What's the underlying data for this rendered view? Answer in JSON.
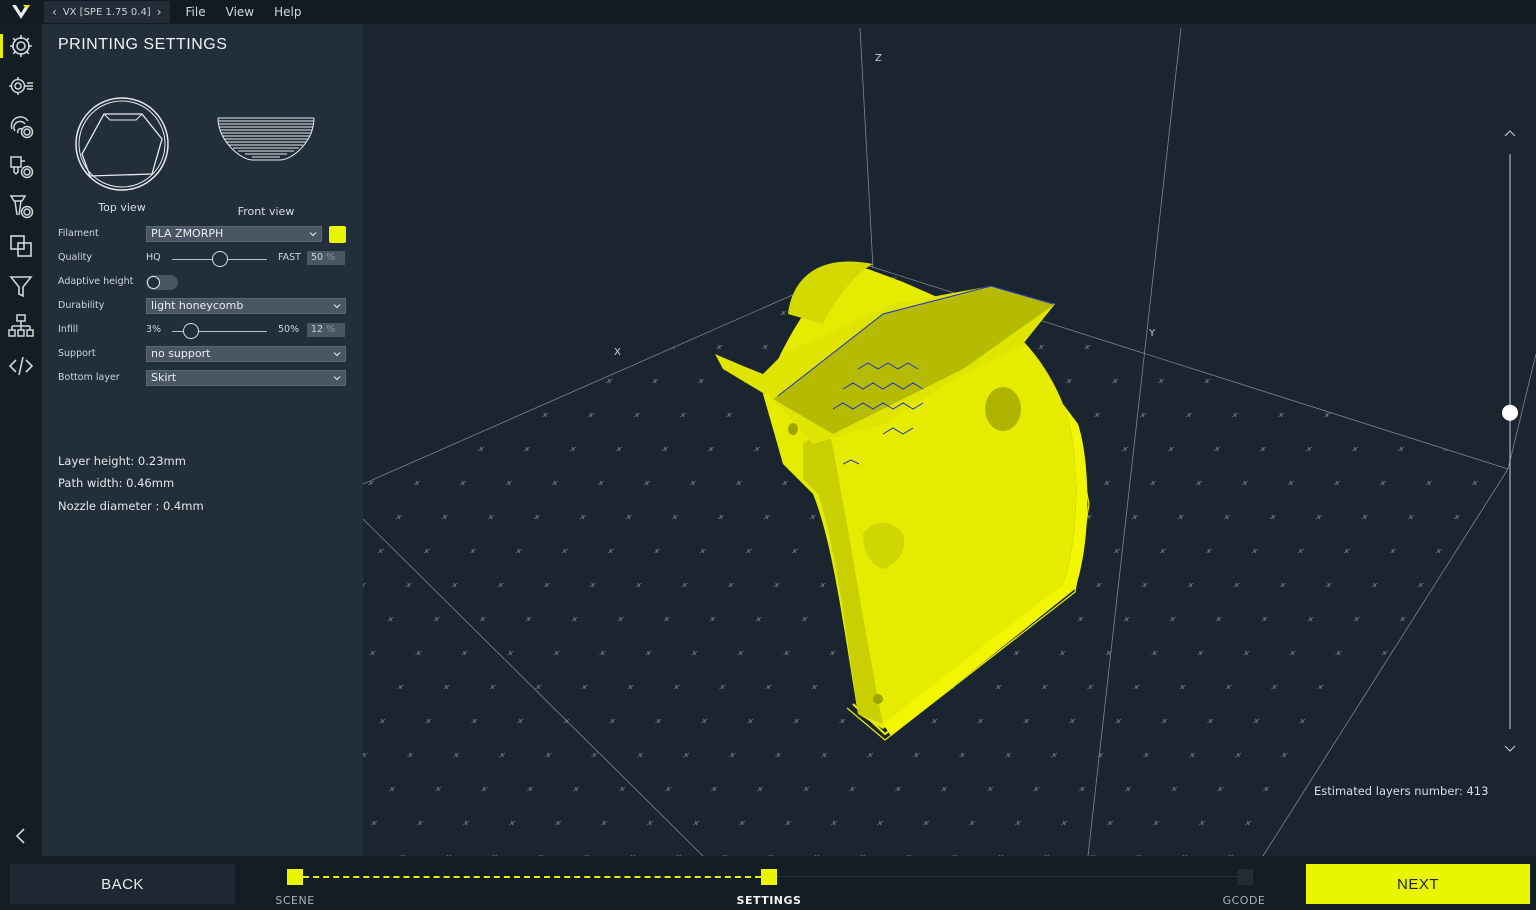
{
  "topbar": {
    "logo_icon": "v-logo-icon",
    "profile_label": "VX [SPE 1.75 0.4]",
    "menu": [
      "File",
      "View",
      "Help"
    ]
  },
  "rail": {
    "icons": [
      "gear-icon",
      "gear-list-icon",
      "fingerprint-gear-icon",
      "extruder-gear-icon",
      "filament-gear-icon",
      "overlap-squares-icon",
      "funnel-icon",
      "hierarchy-icon",
      "code-icon"
    ],
    "collapse_icon": "chevron-left-icon"
  },
  "panel": {
    "title": "PRINTING SETTINGS",
    "top_view_caption": "Top view",
    "front_view_caption": "Front view",
    "filament": {
      "label": "Filament",
      "value": "PLA ZMORPH",
      "color": "#eaf500"
    },
    "quality": {
      "label": "Quality",
      "min": "HQ",
      "max": "FAST",
      "value": "50",
      "unit": "%",
      "level": 0.5
    },
    "adaptive_height": {
      "label": "Adaptive height",
      "on": false
    },
    "durability": {
      "label": "Durability",
      "value": "light honeycomb"
    },
    "infill": {
      "label": "Infill",
      "min": "3%",
      "max": "50%",
      "value": "12",
      "unit": "%",
      "level": 0.2
    },
    "support": {
      "label": "Support",
      "value": "no support"
    },
    "bottom_layer": {
      "label": "Bottom layer",
      "value": "Skirt"
    },
    "info": {
      "layer_height": "Layer height: 0.23mm",
      "path_width": "Path width: 0.46mm",
      "nozzle": "Nozzle diameter : 0.4mm"
    }
  },
  "viewport": {
    "axis_x": "X",
    "axis_y": "Y",
    "axis_z": "Z",
    "estimated_layers": "Estimated layers number: 413",
    "layer_slider_level": 0.55,
    "model_color": "#e8ee00"
  },
  "footer": {
    "back": "BACK",
    "next": "NEXT",
    "steps": [
      "SCENE",
      "SETTINGS",
      "GCODE"
    ],
    "current_step": "SETTINGS"
  },
  "colors": {
    "accent": "#eaf500",
    "panel_bg": "#222e39",
    "viewport_bg": "#1a2530"
  }
}
